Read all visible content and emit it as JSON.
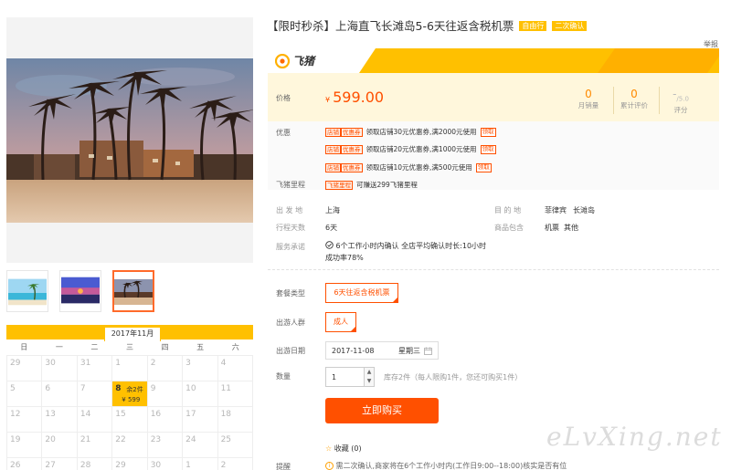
{
  "title": "【限时秒杀】上海直飞长滩岛5-6天往返含税机票",
  "tags": [
    "自由行",
    "二次确认"
  ],
  "report_label": "举报",
  "brand": {
    "name": "飞猪"
  },
  "price": {
    "label": "价格",
    "currency": "¥",
    "value": "599.00"
  },
  "stats": [
    {
      "value": "0",
      "label": "月销量"
    },
    {
      "value": "0",
      "label": "累计评价"
    },
    {
      "value": "-",
      "suffix": "/5.0",
      "label": "评分"
    }
  ],
  "promo": {
    "label": "优惠",
    "shop_badge": "店铺",
    "coupon_badge": "优惠券",
    "get_label": "领取",
    "coupons": [
      "领取店铺30元优惠券,满2000元使用",
      "领取店铺20元优惠券,满1000元使用",
      "领取店铺10元优惠券,满500元使用"
    ]
  },
  "mileage": {
    "label": "飞猪里程",
    "badge": "飞猪里程",
    "text": "可赚送299飞猪里程"
  },
  "info": {
    "depart_label": "出 发 地",
    "depart": "上海",
    "dest_label": "目 的 地",
    "dest_country": "菲律宾",
    "dest_city": "长滩岛",
    "days_label": "行程天数",
    "days": "6天",
    "include_label": "商品包含",
    "include_1": "机票",
    "include_2": "其他",
    "promise_label": "服务承诺",
    "promise_1": "6个工作小时内确认 全店平均确认时长:10小时",
    "promise_2": "成功率78%"
  },
  "options": {
    "package_label": "套餐类型",
    "package": "6天往返含税机票",
    "crowd_label": "出游人群",
    "crowd": "成人",
    "date_label": "出游日期",
    "date": "2017-11-08",
    "weekday": "星期三",
    "qty_label": "数量",
    "qty": "1",
    "stock_text": "库存2件（每人限购1件，您还可购买1件）",
    "buy_label": "立即购买",
    "fav_label": "收藏",
    "fav_count": "(0)",
    "reminder_label": "提醒",
    "reminder_text": "需二次确认,商家将在6个工作小时内(工作日9:00--18:00)核实是否有位"
  },
  "calendar": {
    "month": "2017年11月",
    "weekdays": [
      "日",
      "一",
      "二",
      "三",
      "四",
      "五",
      "六"
    ],
    "rows": [
      [
        "29",
        "30",
        "31",
        "1",
        "2",
        "3",
        "4"
      ],
      [
        "5",
        "6",
        "7",
        "8",
        "9",
        "10",
        "11"
      ],
      [
        "12",
        "13",
        "14",
        "15",
        "16",
        "17",
        "18"
      ],
      [
        "19",
        "20",
        "21",
        "22",
        "23",
        "24",
        "25"
      ],
      [
        "26",
        "27",
        "28",
        "29",
        "30",
        "1",
        "2"
      ]
    ],
    "available": {
      "day": "8",
      "stock": "余2件",
      "price": "¥ 599"
    }
  },
  "watermark": "eLvXing.net",
  "colors": {
    "accent": "#ff5000",
    "brand_yellow": "#ffc000",
    "price_bg": "#fff7dc"
  }
}
